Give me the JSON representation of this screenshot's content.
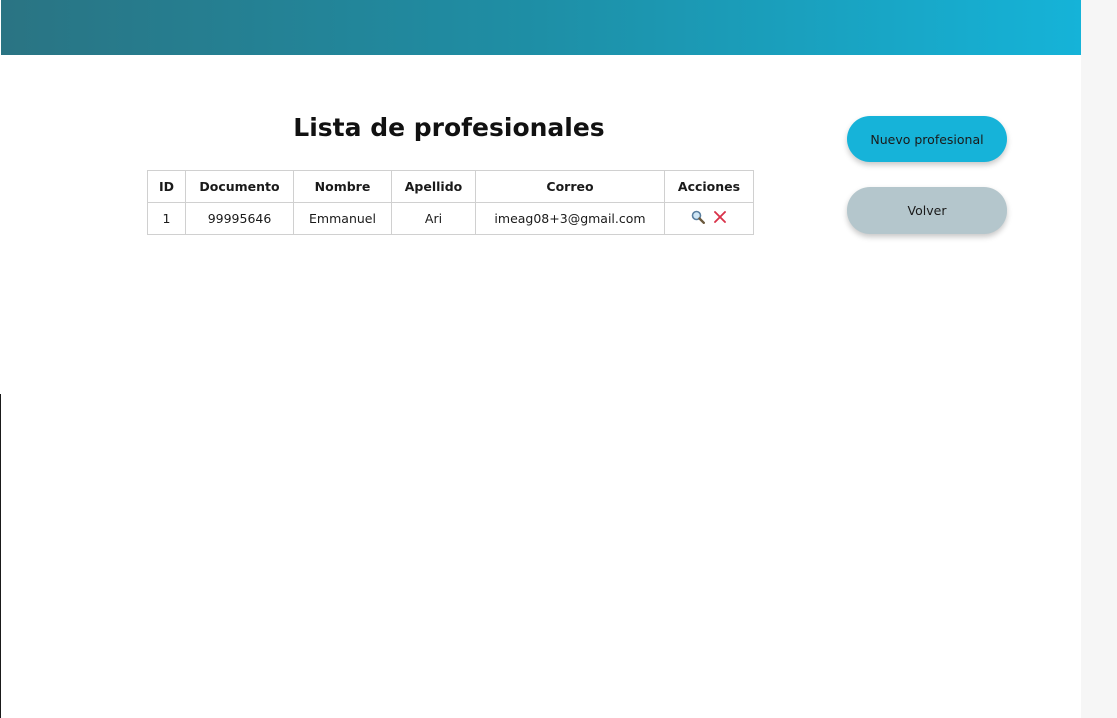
{
  "page": {
    "title": "Lista de profesionales"
  },
  "table": {
    "headers": [
      "ID",
      "Documento",
      "Nombre",
      "Apellido",
      "Correo",
      "Acciones"
    ],
    "rows": [
      {
        "id": "1",
        "documento": "99995646",
        "nombre": "Emmanuel",
        "apellido": "Ari",
        "correo": "imeag08+3@gmail.com",
        "acciones": [
          "search-icon",
          "close-icon"
        ]
      }
    ]
  },
  "buttons": {
    "new_label": "Nuevo profesional",
    "back_label": "Volver"
  },
  "colors": {
    "header_start": "#2a7483",
    "header_end": "#15b3d8",
    "primary_button": "#16b3d9",
    "secondary_button": "#b4c6cc",
    "delete_icon": "#d9324a"
  }
}
